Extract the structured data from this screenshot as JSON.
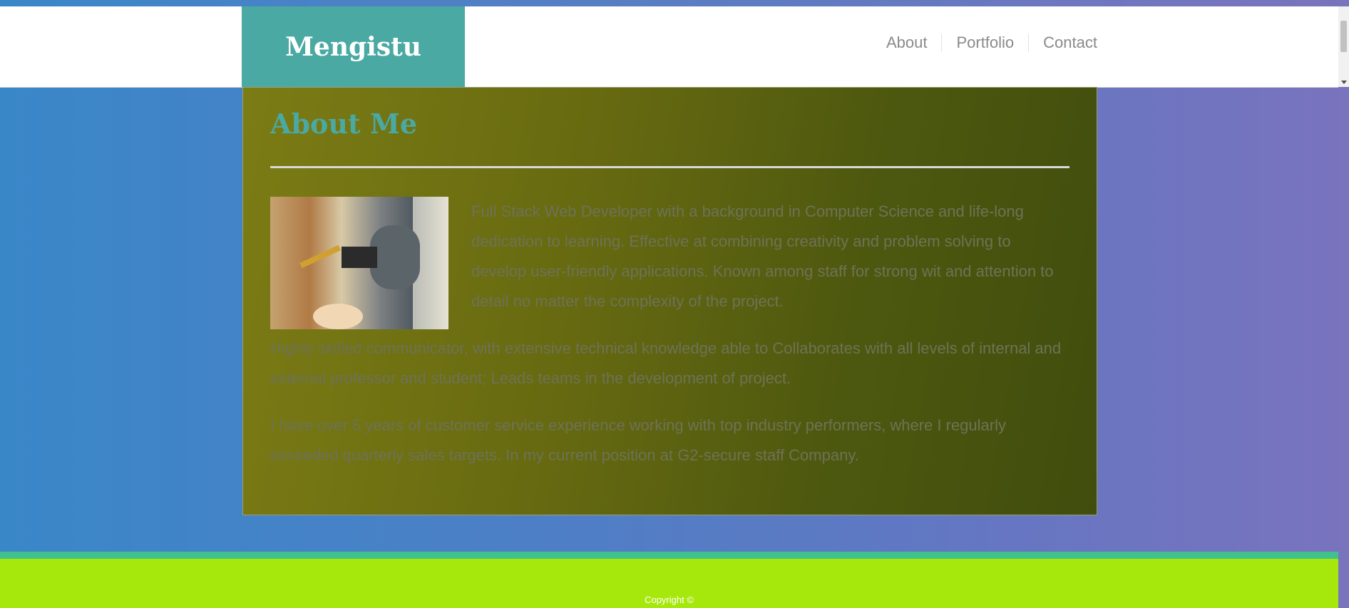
{
  "header": {
    "brand": "Mengistu",
    "nav": [
      "About",
      "Portfolio",
      "Contact"
    ]
  },
  "about": {
    "title": "About Me",
    "paragraphs": [
      "Full Stack Web Developer with a background in Computer Science and life-long dedication to learning. Effective at combining creativity and problem solving to develop user-friendly applications. Known among staff for strong wit and attention to detail no matter the complexity of the project.",
      "Highly skilled communicator, with extensive technical knowledge able to Collaborates with all levels of internal and external professor and student; Leads teams in the development of project.",
      "I have over 5 years of customer service experience working with top industry performers, where I regularly exceeded quarterly sales targets. In my current position at G2-secure staff Company."
    ]
  },
  "footer": {
    "copyright": "Copyright ©"
  },
  "colors": {
    "brand_bg": "#4aa9a3",
    "footer_bg": "#a6e80c",
    "footer_stripe": "#41c28d"
  }
}
